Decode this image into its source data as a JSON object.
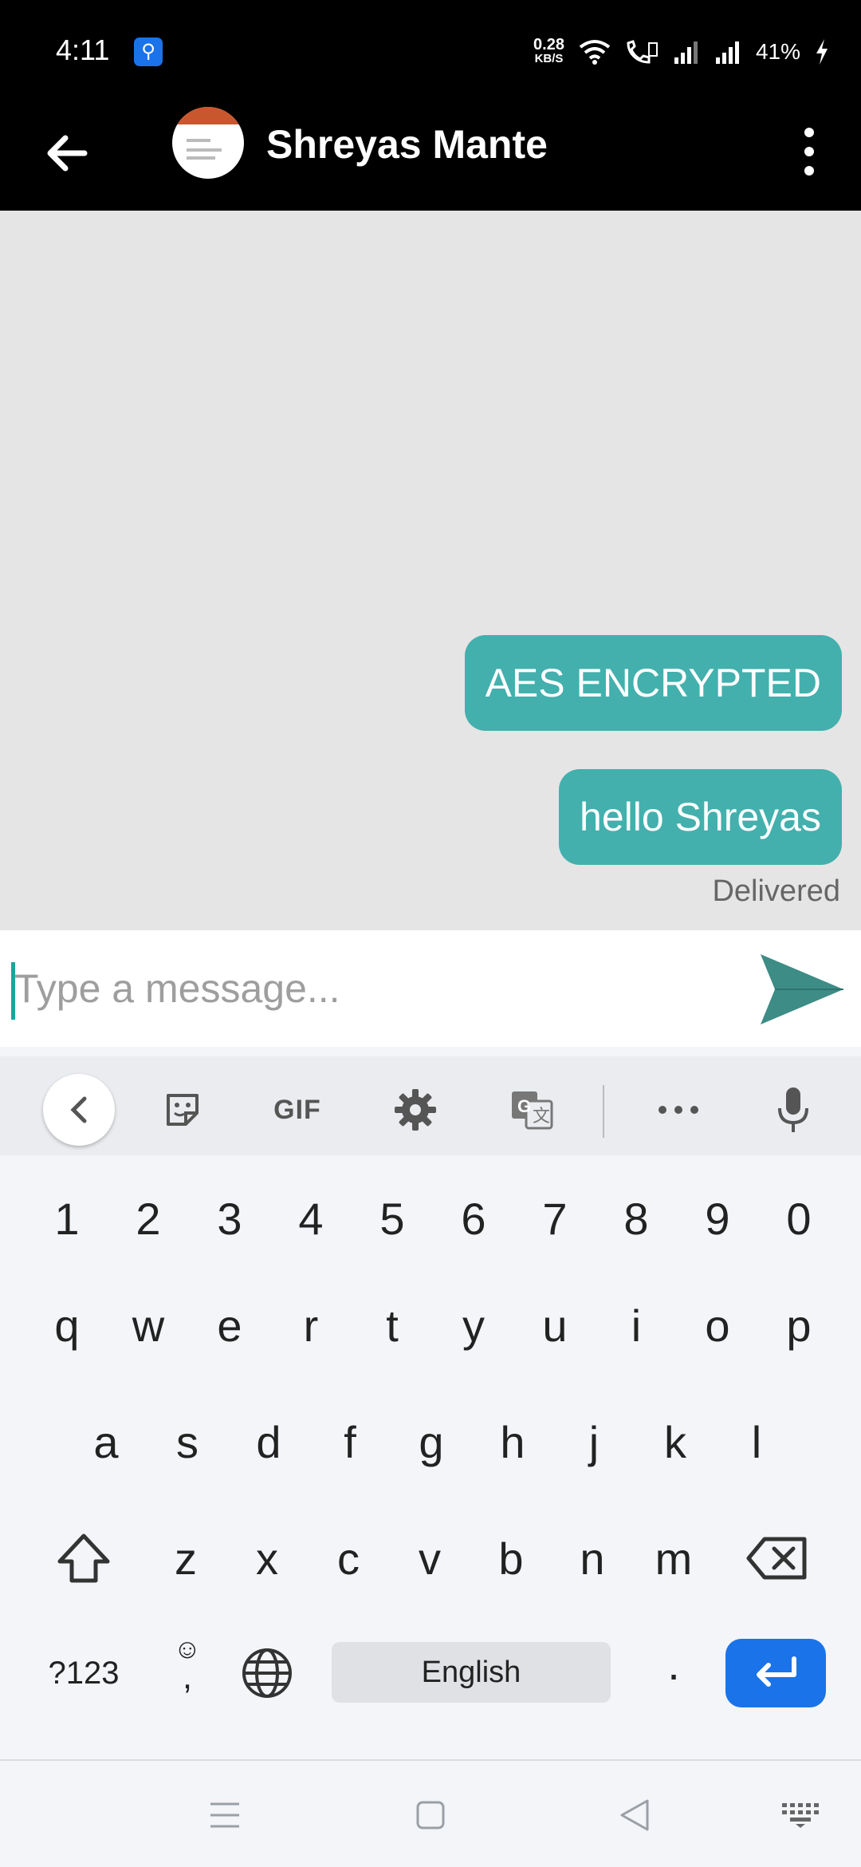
{
  "status_bar": {
    "time": "4:11",
    "net_speed_value": "0.28",
    "net_speed_unit": "KB/S",
    "battery": "41%"
  },
  "header": {
    "contact_name": "Shreyas Mante"
  },
  "messages": [
    {
      "text": "AES ENCRYPTED",
      "direction": "outgoing"
    },
    {
      "text": "hello Shreyas",
      "direction": "outgoing"
    }
  ],
  "delivery_status": "Delivered",
  "composer": {
    "placeholder": "Type a message..."
  },
  "keyboard": {
    "toolbar_gif": "GIF",
    "row_numbers": [
      "1",
      "2",
      "3",
      "4",
      "5",
      "6",
      "7",
      "8",
      "9",
      "0"
    ],
    "row1": [
      "q",
      "w",
      "e",
      "r",
      "t",
      "y",
      "u",
      "i",
      "o",
      "p"
    ],
    "row2": [
      "a",
      "s",
      "d",
      "f",
      "g",
      "h",
      "j",
      "k",
      "l"
    ],
    "row3": [
      "z",
      "x",
      "c",
      "v",
      "b",
      "n",
      "m"
    ],
    "symbols_key": "?123",
    "comma_key": ",",
    "period_key": ".",
    "space_label": "English"
  },
  "colors": {
    "accent": "#43b0ad",
    "send_icon": "#3d8c86",
    "enter_key": "#1a73e8",
    "appbar": "#000000",
    "chat_bg": "#e5e5e5"
  }
}
